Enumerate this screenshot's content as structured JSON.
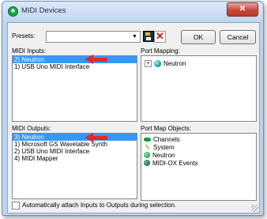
{
  "window": {
    "title": "MIDI Devices",
    "close_glyph": "✕"
  },
  "presets": {
    "label": "Presets:",
    "value": ""
  },
  "toolbar": {
    "ok_label": "OK",
    "cancel_label": "Cancel"
  },
  "midi_inputs": {
    "label": "MIDI Inputs:",
    "items": [
      {
        "text": "2) Neutron",
        "selected": true
      },
      {
        "text": "1) USB Uno MIDI Interface",
        "selected": false
      }
    ]
  },
  "port_mapping": {
    "label": "Port Mapping:",
    "tree_item": "Neutron"
  },
  "midi_outputs": {
    "label": "MIDI Outputs:",
    "items": [
      {
        "text": "3) Neutron",
        "selected": true
      },
      {
        "text": "1) Microsoft GS Wavetable Synth",
        "selected": false
      },
      {
        "text": "2) USB Uno MIDI Interface",
        "selected": false
      },
      {
        "text": "4) MIDI Mapper",
        "selected": false
      }
    ]
  },
  "port_map_objects": {
    "label": "Port Map Objects:",
    "items": [
      {
        "text": "Channels",
        "icon": "channels-icon"
      },
      {
        "text": "System",
        "icon": "system-icon"
      },
      {
        "text": "Neutron",
        "icon": "neutron-icon"
      },
      {
        "text": "MIDI-OX Events",
        "icon": "midiox-events-icon"
      }
    ]
  },
  "auto_attach": {
    "label": "Automatically attach Inputs to Outputs during selection.",
    "checked": false
  },
  "colors": {
    "selection": "#3399ff",
    "annotation_arrow": "#e12a2a"
  }
}
